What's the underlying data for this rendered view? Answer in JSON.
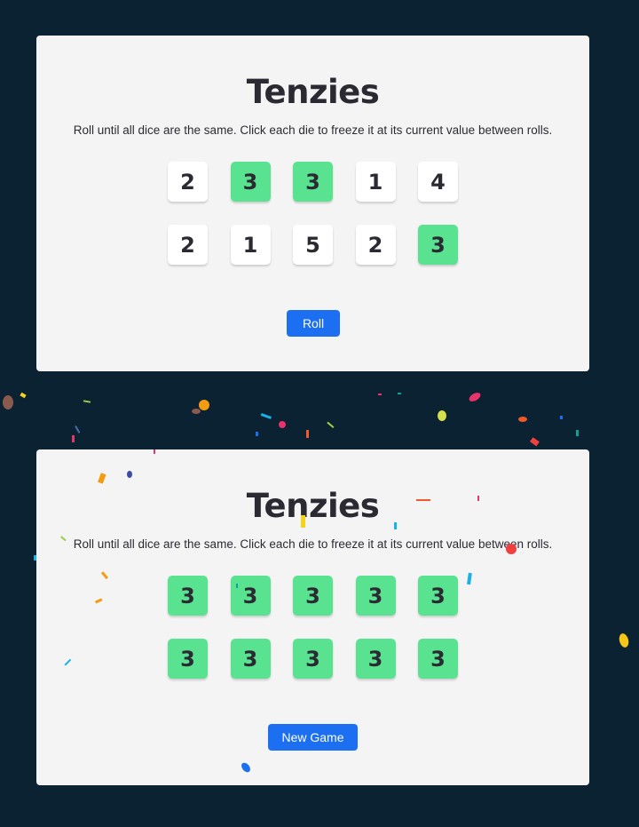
{
  "colors": {
    "background": "#0b2233",
    "panel": "#f4f4f4",
    "die": "#ffffff",
    "die_held": "#59e391",
    "button": "#1d6ff2",
    "text": "#2b2a33"
  },
  "panels": [
    {
      "title": "Tenzies",
      "description": "Roll until all dice are the same. Click each die to freeze it at its current value between rolls.",
      "dice": [
        {
          "value": "2",
          "held": false
        },
        {
          "value": "3",
          "held": true
        },
        {
          "value": "3",
          "held": true
        },
        {
          "value": "1",
          "held": false
        },
        {
          "value": "4",
          "held": false
        },
        {
          "value": "2",
          "held": false
        },
        {
          "value": "1",
          "held": false
        },
        {
          "value": "5",
          "held": false
        },
        {
          "value": "2",
          "held": false
        },
        {
          "value": "3",
          "held": true
        }
      ],
      "button_label": "Roll"
    },
    {
      "title": "Tenzies",
      "description": "Roll until all dice are the same. Click each die to freeze it at its current value between rolls.",
      "dice": [
        {
          "value": "3",
          "held": true
        },
        {
          "value": "3",
          "held": true
        },
        {
          "value": "3",
          "held": true
        },
        {
          "value": "3",
          "held": true
        },
        {
          "value": "3",
          "held": true
        },
        {
          "value": "3",
          "held": true
        },
        {
          "value": "3",
          "held": true
        },
        {
          "value": "3",
          "held": true
        },
        {
          "value": "3",
          "held": true
        },
        {
          "value": "3",
          "held": true
        }
      ],
      "button_label": "New Game"
    }
  ]
}
